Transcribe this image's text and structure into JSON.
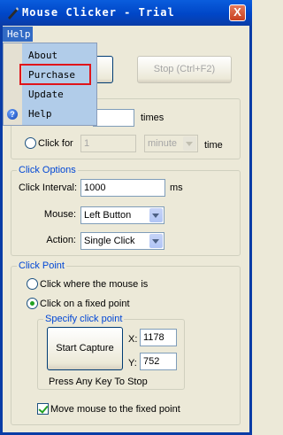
{
  "window": {
    "title": "Mouse Clicker - Trial",
    "close": "X"
  },
  "menubar": {
    "help": "Help"
  },
  "help_menu": {
    "items": [
      {
        "label": "About"
      },
      {
        "label": "Purchase"
      },
      {
        "label": "Update"
      },
      {
        "label": "Help",
        "icon": "question-icon"
      }
    ]
  },
  "toolbar": {
    "start_label": "",
    "stop_label": "Stop (Ctrl+F2)"
  },
  "repeat": {
    "times_value": "",
    "times_label": "times",
    "click_for_label": "Click for",
    "click_for_value": "1",
    "unit": "minute",
    "time_label": "time"
  },
  "click_options": {
    "title": "Click Options",
    "interval_label": "Click Interval:",
    "interval_value": "1000",
    "interval_unit": "ms",
    "mouse_label": "Mouse:",
    "mouse_value": "Left Button",
    "action_label": "Action:",
    "action_value": "Single Click"
  },
  "click_point": {
    "title": "Click Point",
    "where_mouse_label": "Click where the mouse is",
    "fixed_point_label": "Click on a fixed point",
    "specify_title": "Specify click point",
    "capture_button": "Start Capture",
    "x_label": "X:",
    "x_value": "1178",
    "y_label": "Y:",
    "y_value": "752",
    "hint": "Press Any Key To Stop",
    "move_label": "Move mouse to the fixed point"
  },
  "colors": {
    "accent": "#0046d5",
    "title_bar": "#0a5ddd",
    "highlight": "#e0141a"
  }
}
